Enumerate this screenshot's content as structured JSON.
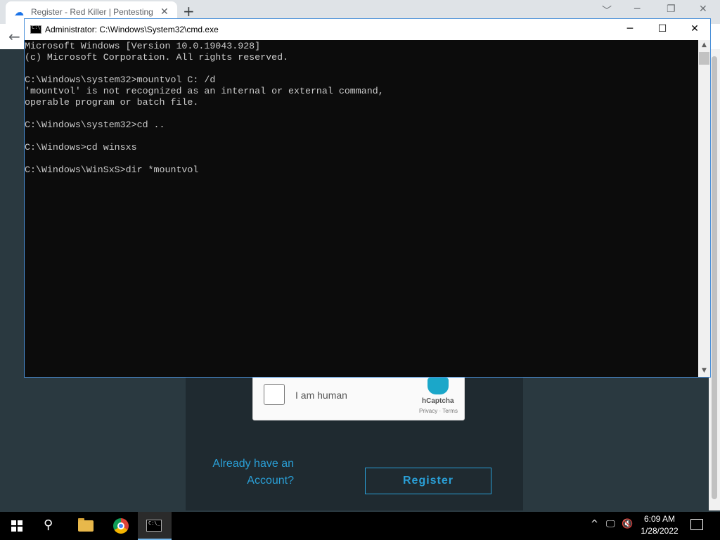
{
  "browser": {
    "tab_title": "Register - Red Killer | Pentesting",
    "tab_close": "✕",
    "new_tab": "+",
    "window_controls": [
      "﹀",
      "─",
      "❐",
      "✕"
    ],
    "back": "←"
  },
  "page": {
    "captcha": {
      "label": "I am human",
      "brand": "hCaptcha",
      "links": "Privacy · Terms"
    },
    "already_line1": "Already have an",
    "already_line2": "Account?",
    "register_label": "Register",
    "accent_color": "#2a9fd6"
  },
  "cmd": {
    "title": "Administrator: C:\\Windows\\System32\\cmd.exe",
    "icon_text": "C:\\_",
    "controls": {
      "minimize": "─",
      "maximize": "☐",
      "close": "✕"
    },
    "lines": [
      "Microsoft Windows [Version 10.0.19043.928]",
      "(c) Microsoft Corporation. All rights reserved.",
      "",
      "C:\\Windows\\system32>mountvol C: /d",
      "'mountvol' is not recognized as an internal or external command,",
      "operable program or batch file.",
      "",
      "C:\\Windows\\system32>cd ..",
      "",
      "C:\\Windows>cd winsxs",
      "",
      "C:\\Windows\\WinSxS>dir *mountvol"
    ],
    "scroll_up": "▲",
    "scroll_down": "▼"
  },
  "taskbar": {
    "search_glyph": "⚲",
    "cmd_icon_text": "C:\\_",
    "tray_chevron": "^",
    "tray_network": "🖵",
    "tray_volume": "🔇",
    "time": "6:09 AM",
    "date": "1/28/2022"
  }
}
